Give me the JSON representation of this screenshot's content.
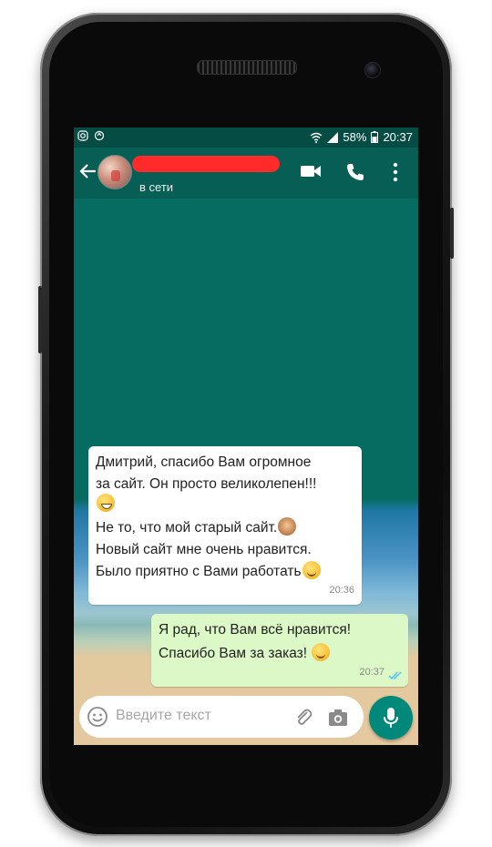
{
  "status_bar": {
    "battery": "58%",
    "time": "20:37",
    "icons": [
      "instagram-icon",
      "sync-icon",
      "wifi-icon",
      "signal-icon",
      "battery-icon"
    ]
  },
  "header": {
    "contact_status": "в сети",
    "icons": [
      "back-arrow-icon",
      "video-call-icon",
      "phone-call-icon",
      "more-vert-icon"
    ]
  },
  "messages": [
    {
      "direction": "incoming",
      "lines": [
        "Дмитрий, спасибо Вам огромное",
        "за сайт. Он просто великолепен!!!",
        "",
        "Не то, что мой старый сайт.",
        "Новый сайт мне очень нравится.",
        "Было приятно с Вами работать"
      ],
      "time": "20:36"
    },
    {
      "direction": "outgoing",
      "lines": [
        "Я рад, что Вам всё нравится!",
        "Спасибо Вам за заказ!"
      ],
      "time": "20:37",
      "status_icon": "double-check-icon"
    }
  ],
  "composer": {
    "placeholder": "Введите текст",
    "icons": [
      "emoji-icon",
      "attach-icon",
      "camera-icon",
      "mic-icon"
    ]
  },
  "colors": {
    "header": "#075e54",
    "statusbar": "#054d44",
    "outgoing_bubble": "#dcf8c6",
    "incoming_bubble": "#ffffff",
    "fab": "#00897b",
    "redaction": "#ff2a2a"
  }
}
